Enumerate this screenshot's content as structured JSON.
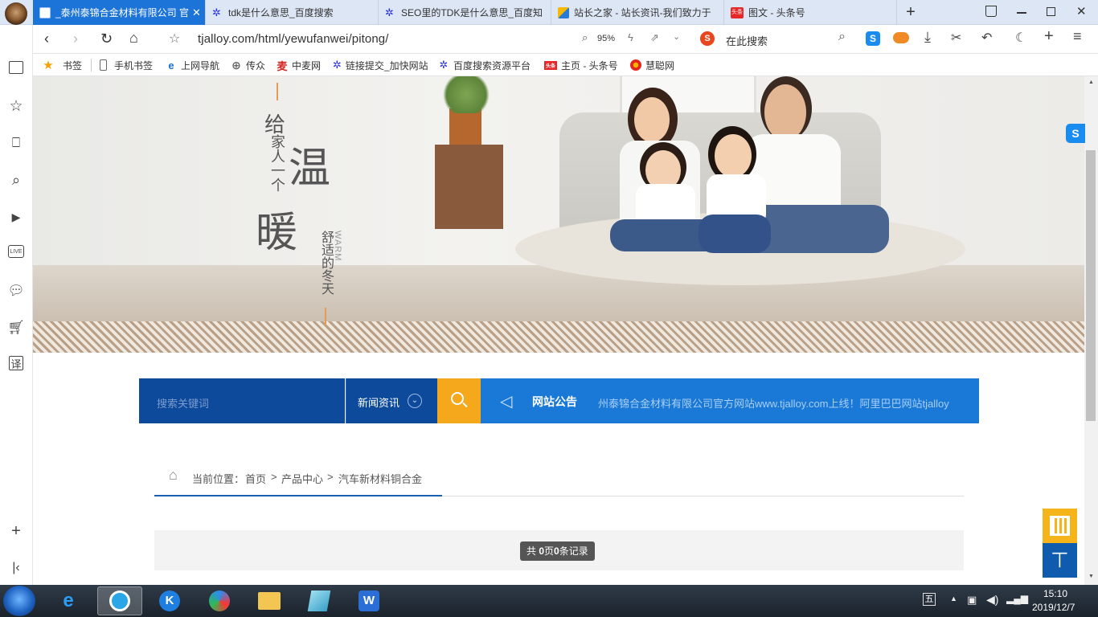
{
  "browser": {
    "tabs": [
      {
        "label": "_泰州泰锦合金材料有限公司 官",
        "active": true
      },
      {
        "label": "tdk是什么意思_百度搜索",
        "active": false
      },
      {
        "label": "SEO里的TDK是什么意思_百度知",
        "active": false
      },
      {
        "label": "站长之家 - 站长资讯-我们致力于",
        "active": false
      },
      {
        "label": "图文 - 头条号",
        "active": false
      }
    ],
    "tab_icon_colors": {
      "baidu": "#2932e1",
      "chinaz": "#f6b800",
      "toutiao": "#e62828"
    },
    "toutiao_badge": "头条",
    "address": "tjalloy.com/html/yewufanwei/pitong/",
    "zoom": "95%",
    "search_placeholder": "在此搜索",
    "bookmarks": [
      {
        "label": "书签",
        "icon": "star-icon"
      },
      {
        "label": "手机书签",
        "icon": "phone-icon"
      },
      {
        "label": "上网导航",
        "icon": "ie-icon"
      },
      {
        "label": "传众",
        "icon": "globe-icon"
      },
      {
        "label": "中麦网",
        "icon": "mai-icon"
      },
      {
        "label": "链接提交_加快网站",
        "icon": "baidu-paw-icon"
      },
      {
        "label": "百度搜索资源平台",
        "icon": "baidu-paw-icon"
      },
      {
        "label": "主页 - 头条号",
        "icon": "toutiao-icon"
      },
      {
        "label": "慧聪网",
        "icon": "huicong-icon"
      }
    ],
    "bookmark_glyphs": {
      "mai": "麦",
      "ie": "e"
    }
  },
  "banner": {
    "line1": "给",
    "line2": "家人一个",
    "big1": "温",
    "big2": "暖",
    "sub": "舒适的冬天",
    "en": "WARM"
  },
  "searchbar": {
    "placeholder": "搜索关键词",
    "category": "新闻资讯",
    "notice_label": "网站公告",
    "notice_text": "州泰锦合金材料有限公司官方网站www.tjalloy.com上线！阿里巴巴网站tjalloy"
  },
  "breadcrumb": {
    "prefix": "当前位置：",
    "items": [
      "首页",
      "产品中心",
      "汽车新材料铜合金"
    ],
    "sep": ">"
  },
  "pager": {
    "text_a": "共 ",
    "pages": "0",
    "text_b": "页",
    "records": "0",
    "text_c": "条记录"
  },
  "taskbar": {
    "time": "15:10",
    "date": "2019/12/7",
    "ime": "五"
  },
  "colors": {
    "tab_active": "#1d74d8",
    "search_dark": "#0d4a9c",
    "search_btn": "#f5a81c",
    "notice_bg": "#1a78d6",
    "qr_bg": "#f5b41a",
    "totop_bg": "#0f5cae"
  }
}
